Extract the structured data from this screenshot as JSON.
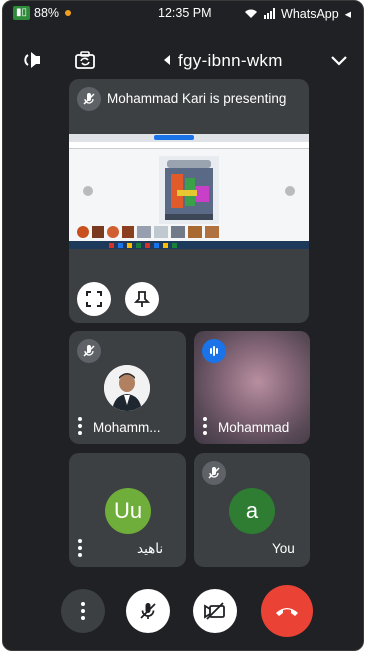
{
  "status_bar": {
    "battery": "88%",
    "time": "12:35 PM",
    "app": "WhatsApp",
    "back_arrow": "◂"
  },
  "header": {
    "meeting_code": "fgy-ibnn-wkm",
    "icons": [
      "chevron-down-icon",
      "switch-camera-icon",
      "speaker-icon"
    ]
  },
  "presentation": {
    "label": "Mohammad Kari is presenting",
    "toolbar_colors": [
      "#d93025",
      "#1a73e8",
      "#fbbc04",
      "#188038"
    ]
  },
  "participants": [
    {
      "name": "Mohamm...",
      "muted": true,
      "avatar": "photo"
    },
    {
      "name": "Mohammad",
      "muted": false,
      "speaking": true,
      "avatar": "blurred-video"
    },
    {
      "name": "ناهید",
      "muted": false,
      "initials": "Uu",
      "color": "#6fae3a"
    },
    {
      "name": "You",
      "muted": true,
      "initials": "a",
      "color": "#2e7d32"
    }
  ],
  "controls": {
    "more": "more-options",
    "mic": "mic-off",
    "camera": "camera-off",
    "end_call": "end-call",
    "end_call_color": "#ea4335"
  }
}
